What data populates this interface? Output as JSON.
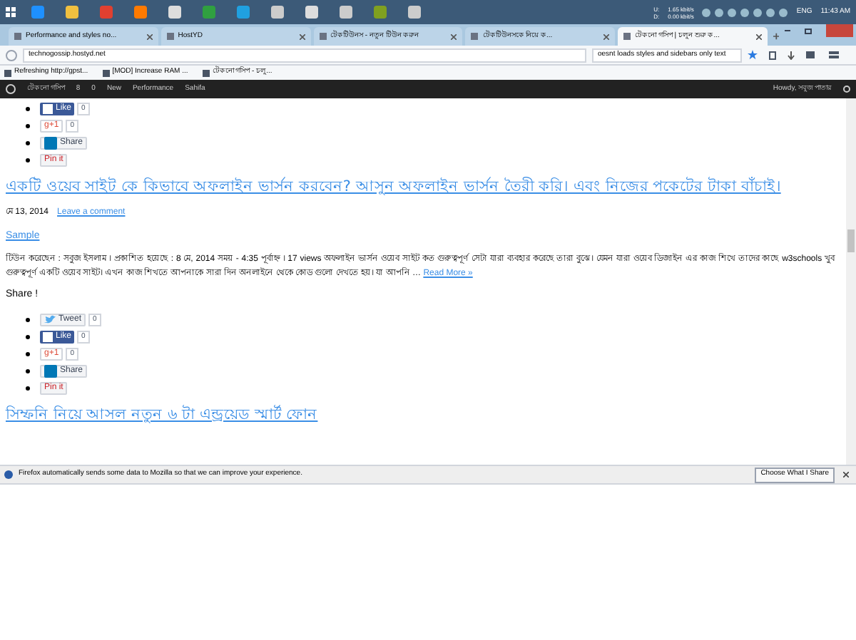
{
  "taskbar": {
    "net_up_label": "U:",
    "net_down_label": "D:",
    "net_up": "1.65 kbit/s",
    "net_down": "0.00 kbit/s",
    "lang": "ENG",
    "time": "11:43 AM"
  },
  "tabs": [
    {
      "label": "Performance and styles no...",
      "selected": false
    },
    {
      "label": "HostYD",
      "selected": false
    },
    {
      "label": "টেকটিউনস - নতুন টিউন করুন",
      "selected": false
    },
    {
      "label": "টেকটিউনসকে নিয়ে ক...",
      "selected": false
    },
    {
      "label": "টেকনো গসিপ | চলুন শুরু ক...",
      "selected": true
    }
  ],
  "address": {
    "url": "technogossip.hostyd.net",
    "search": "oesnt loads styles and sidebars only text"
  },
  "bookmarks": [
    "Refreshing http://gpst...",
    "[MOD] Increase RAM ...",
    "টেকনো গসিপ - চলু..."
  ],
  "admin_bar": {
    "site": "টেকনো গসিপ",
    "updates": "8",
    "comments": "0",
    "new": "New",
    "items": [
      "Performance",
      "Sahifa"
    ],
    "howdy": "Howdy, সবুজ পাতার"
  },
  "content": [
    {
      "kind": "share",
      "buttons": [
        {
          "kind": "facebook",
          "label": "Like",
          "count": "0"
        },
        {
          "kind": "gplus",
          "label": "g+1",
          "count": "0"
        },
        {
          "kind": "linkedin",
          "label": "Share"
        },
        {
          "kind": "pinterest",
          "label": "Pin it"
        }
      ]
    },
    {
      "kind": "title",
      "text": "একটি ওয়েব সাইট কে কিভাবে অফলাইন ভার্সন করবেন? আসুন অফলাইন ভার্সন তৈরী করি। এবং নিজের পকেটের টাকা বাঁচাই।"
    },
    {
      "kind": "meta",
      "date": "মে 13, 2014",
      "link": "Leave a comment"
    },
    {
      "kind": "category",
      "text": "Sample"
    },
    {
      "kind": "excerpt",
      "text": "টিউন করেছেন : সবুজ ইসলাম । প্রকাশিত হয়েছে : 8 মে, 2014 সময় - 4:35 পূর্বাহ্ন । 17 views অফলাইন ভার্সন ওয়েব সাইট কত গুরুত্বপূর্ণ সেটা যারা ব্যবহার করেছে তারা বুঝে। যেমন যারা ওয়েব ডিজাইন এর কাজ শিখে তাদের কাছে w3schools খুব গুরুত্বপূর্ণ একটি ওয়েব সাইট। এখন কাজ শিখতে আপনাকে সারা দিন অনলাইনে থেকে কোড গুলো দেখতে হয়। যা আপনি …",
      "more": "Read More »"
    },
    {
      "kind": "heading",
      "text": "Share !"
    },
    {
      "kind": "share",
      "buttons": [
        {
          "kind": "twitter",
          "label": "Tweet",
          "count": "0"
        },
        {
          "kind": "facebook",
          "label": "Like",
          "count": "0"
        },
        {
          "kind": "gplus",
          "label": "g+1",
          "count": "0"
        },
        {
          "kind": "linkedin",
          "label": "Share"
        },
        {
          "kind": "pinterest",
          "label": "Pin it"
        }
      ]
    },
    {
      "kind": "title",
      "text": "সিম্ফনি নিয়ে আসল নতুন ৬ টা এন্ড্রয়েড স্মার্ট ফোন"
    }
  ],
  "notification": {
    "text": "Firefox automatically sends some data to Mozilla so that we can improve your experience.",
    "button": "Choose What I Share"
  }
}
